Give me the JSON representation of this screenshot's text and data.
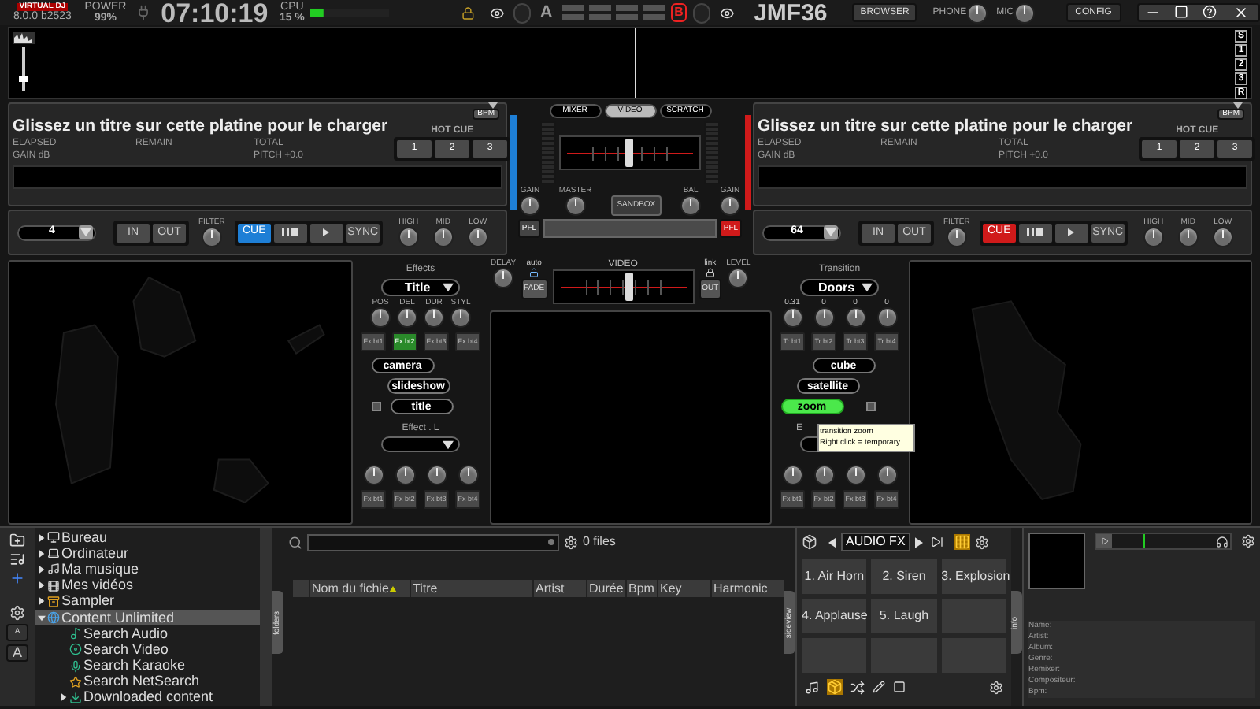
{
  "topbar": {
    "logo": "VIRTUAL DJ",
    "version": "8.0.0 b2523",
    "power_label": "POWER",
    "power": "99%",
    "clock": "07:10:19",
    "cpu_label": "CPU",
    "cpu": "15 %",
    "letter_a": "A",
    "letter_b": "B",
    "user": "JMF36",
    "browser": "BROWSER",
    "phone": "PHONE",
    "mic": "MIC",
    "config": "CONFIG"
  },
  "waveform": {
    "buttons": [
      "S",
      "1",
      "2",
      "3",
      "R"
    ],
    "zoom": {
      "level": 0.3
    }
  },
  "decks": [
    {
      "color": "#1e7fd6",
      "title": "Glissez un titre sur cette platine pour le charger",
      "elapsed": "ELAPSED",
      "remain": "REMAIN",
      "total": "TOTAL",
      "gain": "GAIN dB",
      "pitch": "PITCH +0.0",
      "hotcue_label": "HOT CUE",
      "hotcues": [
        "1",
        "2",
        "3"
      ],
      "bpm": "BPM",
      "loop": "4",
      "in": "IN",
      "out": "OUT",
      "filter": "FILTER",
      "cue": "CUE",
      "sync": "SYNC",
      "eq": [
        "HIGH",
        "MID",
        "LOW"
      ]
    },
    {
      "color": "#d01a1a",
      "title": "Glissez un titre sur cette platine pour le charger",
      "elapsed": "ELAPSED",
      "remain": "REMAIN",
      "total": "TOTAL",
      "gain": "GAIN dB",
      "pitch": "PITCH +0.0",
      "hotcue_label": "HOT CUE",
      "hotcues": [
        "1",
        "2",
        "3"
      ],
      "bpm": "BPM",
      "loop": "64",
      "in": "IN",
      "out": "OUT",
      "filter": "FILTER",
      "cue": "CUE",
      "sync": "SYNC",
      "eq": [
        "HIGH",
        "MID",
        "LOW"
      ]
    }
  ],
  "mixer": {
    "tabs": [
      {
        "label": "MIXER",
        "selected": false
      },
      {
        "label": "VIDEO",
        "selected": true
      },
      {
        "label": "SCRATCH",
        "selected": false
      }
    ],
    "crossfader": {
      "level": 0.5
    },
    "gain_left": "GAIN",
    "master": "MASTER",
    "sandbox": "SANDBOX",
    "bal": "BAL",
    "gain_right": "GAIN",
    "pfl": [
      {
        "label": "PFL",
        "on": false
      },
      {
        "label": "PFL",
        "on": true
      }
    ]
  },
  "video_mixer": {
    "delay": "DELAY",
    "auto": "auto",
    "fade": "FADE",
    "label": "VIDEO",
    "crossfader": {
      "level": 0.55
    },
    "link": "link",
    "out": "OUT",
    "level_label": "LEVEL"
  },
  "effects": {
    "title": "Effects",
    "selector": "Title",
    "knobs": [
      "POS",
      "DEL",
      "DUR",
      "STYL"
    ],
    "buttons": [
      {
        "label": "Fx bt1",
        "selected": false
      },
      {
        "label": "Fx bt2",
        "selected": true
      },
      {
        "label": "Fx bt3",
        "selected": false
      },
      {
        "label": "Fx bt4",
        "selected": false
      }
    ],
    "pills": [
      {
        "label": "camera",
        "selected": false
      },
      {
        "label": "slideshow",
        "selected": false
      },
      {
        "label": "title",
        "selected": false
      }
    ],
    "effect_label": "Effect . L",
    "buttons2": [
      "Fx bt1",
      "Fx bt2",
      "Fx bt3",
      "Fx bt4"
    ]
  },
  "transition": {
    "title": "Transition",
    "selector": "Doors",
    "values": [
      "0.31",
      "0",
      "0",
      "0"
    ],
    "buttons": [
      "Tr bt1",
      "Tr bt2",
      "Tr bt3",
      "Tr bt4"
    ],
    "pills": [
      {
        "label": "cube",
        "selected": false
      },
      {
        "label": "satellite",
        "selected": false
      },
      {
        "label": "zoom",
        "selected": true
      }
    ],
    "effect_label": "E",
    "buttons2": [
      "Fx bt1",
      "Fx bt2",
      "Fx bt3",
      "Fx bt4"
    ],
    "tooltip": [
      "transition zoom",
      "Right click = temporary"
    ]
  },
  "browser": {
    "font_buttons": [
      "A",
      "A"
    ],
    "tree": [
      {
        "label": "Bureau",
        "kind": "desktop",
        "expanded": false,
        "selected": false
      },
      {
        "label": "Ordinateur",
        "kind": "computer",
        "expanded": false,
        "selected": false
      },
      {
        "label": "Ma musique",
        "kind": "music",
        "expanded": false,
        "selected": false
      },
      {
        "label": "Mes vidéos",
        "kind": "video",
        "expanded": false,
        "selected": false
      },
      {
        "label": "Sampler",
        "kind": "sampler",
        "expanded": false,
        "selected": false
      },
      {
        "label": "Content Unlimited",
        "kind": "globe",
        "expanded": true,
        "selected": true,
        "children": [
          {
            "label": "Search Audio",
            "kind": "audio",
            "selected": false
          },
          {
            "label": "Search Video",
            "kind": "film",
            "selected": false
          },
          {
            "label": "Search Karaoke",
            "kind": "karaoke",
            "selected": false
          },
          {
            "label": "Search NetSearch",
            "kind": "net",
            "selected": false
          },
          {
            "label": "Downloaded content",
            "kind": "download",
            "expanded": false,
            "selected": false
          }
        ]
      }
    ],
    "folders_tab": "folders",
    "files": "0 files",
    "columns": [
      {
        "label": "Nom du fichie",
        "sorted": true
      },
      {
        "label": "Titre",
        "sorted": false
      },
      {
        "label": "Artist",
        "sorted": false
      },
      {
        "label": "Durée",
        "sorted": false
      },
      {
        "label": "Bpm",
        "sorted": false
      },
      {
        "label": "Key",
        "sorted": false
      },
      {
        "label": "Harmonic",
        "sorted": false
      }
    ],
    "sideview_tab": "sideview",
    "sideview": {
      "title": "AUDIO FX",
      "pads": [
        "1. Air Horn",
        "2. Siren",
        "3. Explosion",
        "4. Applause",
        "5. Laugh"
      ]
    },
    "info_tab": "info",
    "info_fields": [
      "Name:",
      "Artist:",
      "Album:",
      "Genre:",
      "Remixer:",
      "Compositeur:",
      "Bpm:"
    ]
  }
}
